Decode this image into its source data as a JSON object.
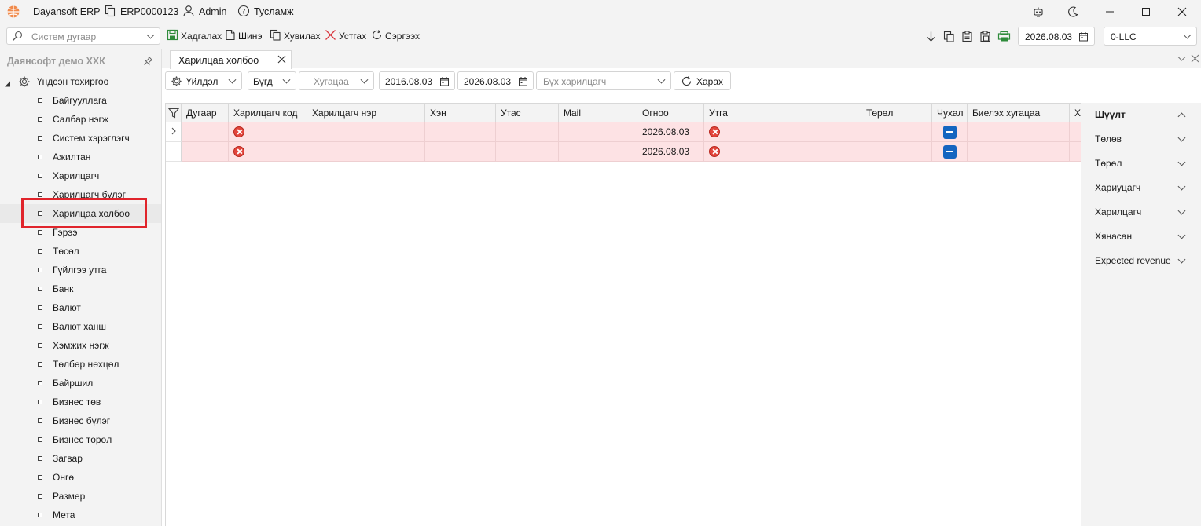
{
  "titlebar": {
    "app_name": "Dayansoft ERP",
    "erp_code": "ERP0000123",
    "user": "Admin",
    "help": "Тусламж"
  },
  "toolbar": {
    "search_placeholder": "Систем дугаар",
    "save": "Хадгалах",
    "new": "Шинэ",
    "copy": "Хувилах",
    "delete": "Устгах",
    "refresh": "Сэргээх",
    "date": "2026.08.03",
    "company": "0-LLC"
  },
  "sidebar": {
    "header": "Даянсофт демо ХХК",
    "root": "Үндсэн тохиргоо",
    "items": [
      "Байгууллага",
      "Салбар нэгж",
      "Систем хэрэглэгч",
      "Ажилтан",
      "Харилцагч",
      "Харилцагч бүлэг",
      "Харилцаа холбоо",
      "Гэрээ",
      "Төсөл",
      "Гүйлгээ утга",
      "Банк",
      "Валют",
      "Валют ханш",
      "Хэмжих нэгж",
      "Төлбөр нөхцөл",
      "Байршил",
      "Бизнес төв",
      "Бизнес бүлэг",
      "Бизнес төрөл",
      "Загвар",
      "Өнгө",
      "Размер",
      "Мета"
    ],
    "selected_index": 6
  },
  "tab": {
    "title": "Харилцаа холбоо"
  },
  "filterbar": {
    "action": "Үйлдэл",
    "all": "Бүгд",
    "period_placeholder": "Хугацаа",
    "date_from": "2016.08.03",
    "date_to": "2026.08.03",
    "partner_placeholder": "Бүх харилцагч",
    "view": "Харах"
  },
  "grid": {
    "columns": [
      "Дугаар",
      "Харилцагч код",
      "Харилцагч нэр",
      "Хэн",
      "Утас",
      "Mail",
      "Огноо",
      "Утга",
      "Төрөл",
      "Чухал",
      "Биелэх хугацаа",
      "Х"
    ],
    "rows": [
      {
        "number": "",
        "partner_code": "error",
        "partner_name": "",
        "who": "",
        "phone": "",
        "mail": "",
        "date": "2026.08.03",
        "value": "error",
        "type": "",
        "important": "checked",
        "due": ""
      },
      {
        "number": "",
        "partner_code": "error",
        "partner_name": "",
        "who": "",
        "phone": "",
        "mail": "",
        "date": "2026.08.03",
        "value": "error",
        "type": "",
        "important": "checked",
        "due": ""
      }
    ],
    "row_error_color": "#fde2e4"
  },
  "right_panel": {
    "items": [
      "Шүүлт",
      "Төлөв",
      "Төрөл",
      "Хариуцагч",
      "Харилцагч",
      "Хянасан",
      "Expected revenue"
    ]
  },
  "colors": {
    "highlight": "#e0242b",
    "accent": "#1565c0",
    "error": "#e2453c"
  }
}
